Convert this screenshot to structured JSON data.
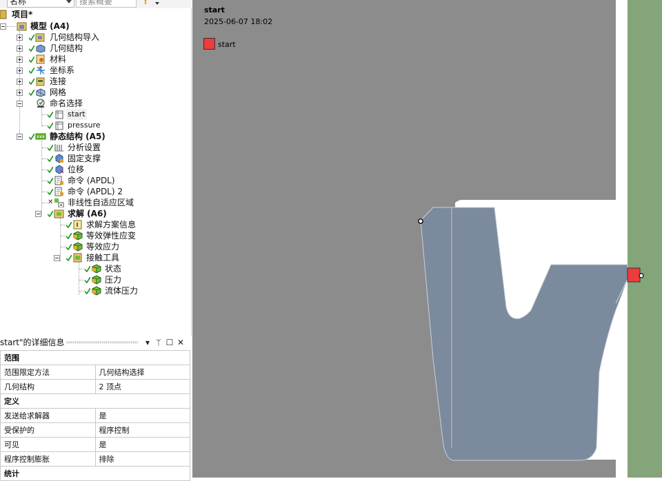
{
  "toolbar": {
    "name_select": "名称",
    "search_placeholder": "搜索概要"
  },
  "tree": {
    "project": "项目*",
    "model": "模型 (A4)",
    "geometry_import": "几何结构导入",
    "geometry": "几何结构",
    "materials": "材料",
    "coordinate_systems": "坐标系",
    "connections": "连接",
    "mesh": "网格",
    "named_selections": "命名选择",
    "ns_start": "start",
    "ns_pressure": "pressure",
    "static_structural": "静态结构 (A5)",
    "analysis_settings": "分析设置",
    "fixed_support": "固定支撑",
    "displacement": "位移",
    "command_apdl": "命令 (APDL)",
    "command_apdl_2": "命令 (APDL) 2",
    "nonlinear_adaptive_region": "非线性自适应区域",
    "solution": "求解 (A6)",
    "solution_information": "求解方案信息",
    "equivalent_elastic_strain": "等效弹性应变",
    "equivalent_stress": "等效应力",
    "contact_tool": "接触工具",
    "status": "状态",
    "pressure": "压力",
    "fluid_pressure": "流体压力"
  },
  "details": {
    "title": "start\"的详细信息",
    "pin": "ᛘ",
    "rows": [
      {
        "section": "范围"
      },
      {
        "key": "范围限定方法",
        "value": "几何结构选择"
      },
      {
        "key": "几何结构",
        "value": "2 顶点"
      },
      {
        "section": "定义"
      },
      {
        "key": "发送给求解器",
        "value": "是"
      },
      {
        "key": "受保护的",
        "value": "程序控制"
      },
      {
        "key": "可见",
        "value": "是"
      },
      {
        "key": "程序控制膨胀",
        "value": "排除"
      },
      {
        "section": "统计"
      }
    ]
  },
  "viewport": {
    "title": "start",
    "timestamp": "2025-06-07 18:02",
    "legend_label": "start",
    "colors": {
      "background": "#8c8c8c",
      "seal": "#7b8a9c",
      "right_wall": "#84a47a",
      "highlight": "#ee3c3c"
    }
  },
  "icons": {
    "tree_check": "green-check-icon",
    "tree_excluded": "x-mark-icon",
    "filter": "filter-icon",
    "panel_menu": "chevron-down-icon",
    "panel_pin": "pin-icon",
    "panel_maximize": "maximize-icon",
    "panel_close": "close-icon"
  }
}
